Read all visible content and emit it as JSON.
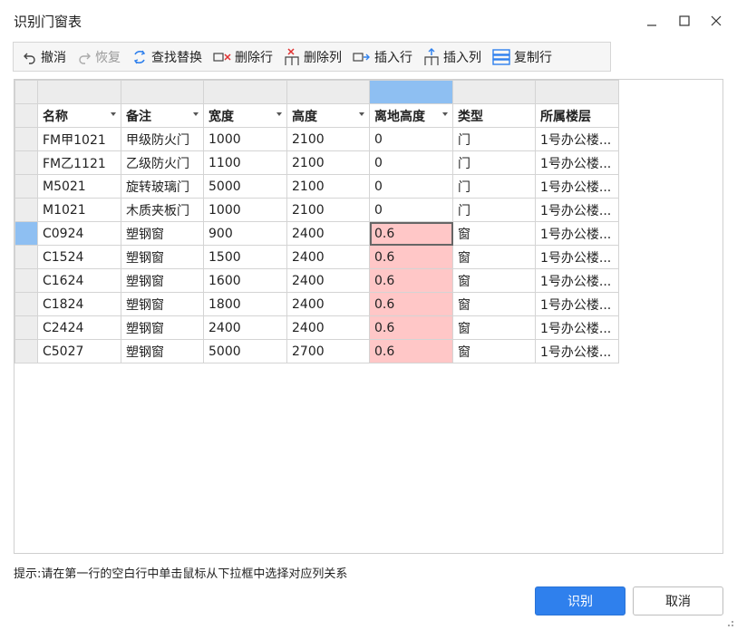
{
  "window": {
    "title": "识别门窗表"
  },
  "toolbar": {
    "undo": "撤消",
    "redo": "恢复",
    "find_replace": "查找替换",
    "delete_row": "删除行",
    "delete_col": "删除列",
    "insert_row": "插入行",
    "insert_col": "插入列",
    "copy_row": "复制行"
  },
  "table": {
    "headers": [
      "名称",
      "备注",
      "宽度",
      "高度",
      "离地高度",
      "类型",
      "所属楼层"
    ],
    "rows": [
      [
        "FM甲1021",
        "甲级防火门",
        "1000",
        "2100",
        "0",
        "门",
        "1号办公楼..."
      ],
      [
        "FM乙1121",
        "乙级防火门",
        "1100",
        "2100",
        "0",
        "门",
        "1号办公楼..."
      ],
      [
        "M5021",
        "旋转玻璃门",
        "5000",
        "2100",
        "0",
        "门",
        "1号办公楼..."
      ],
      [
        "M1021",
        "木质夹板门",
        "1000",
        "2100",
        "0",
        "门",
        "1号办公楼..."
      ],
      [
        "C0924",
        "塑钢窗",
        "900",
        "2400",
        "0.6",
        "窗",
        "1号办公楼..."
      ],
      [
        "C1524",
        "塑钢窗",
        "1500",
        "2400",
        "0.6",
        "窗",
        "1号办公楼..."
      ],
      [
        "C1624",
        "塑钢窗",
        "1600",
        "2400",
        "0.6",
        "窗",
        "1号办公楼..."
      ],
      [
        "C1824",
        "塑钢窗",
        "1800",
        "2400",
        "0.6",
        "窗",
        "1号办公楼..."
      ],
      [
        "C2424",
        "塑钢窗",
        "2400",
        "2400",
        "0.6",
        "窗",
        "1号办公楼..."
      ],
      [
        "C5027",
        "塑钢窗",
        "5000",
        "2700",
        "0.6",
        "窗",
        "1号办公楼..."
      ]
    ]
  },
  "hint": "提示:请在第一行的空白行中单击鼠标从下拉框中选择对应列关系",
  "buttons": {
    "ok": "识别",
    "cancel": "取消"
  },
  "colors": {
    "accent": "#2f80ed",
    "selection": "#8ebff2",
    "highlight": "#ffc7c7"
  }
}
